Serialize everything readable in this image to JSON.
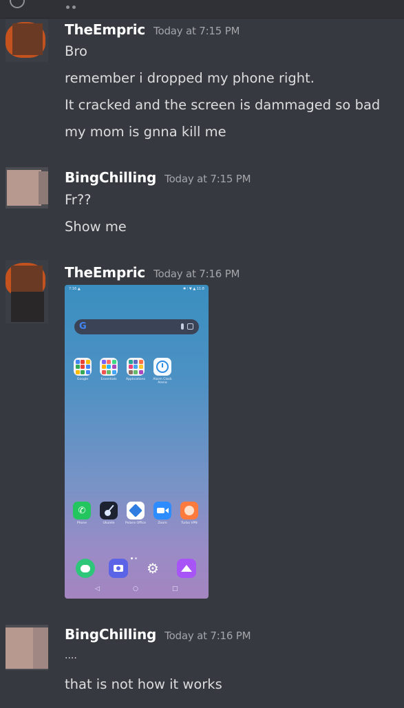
{
  "messages": [
    {
      "username": "TheEmpric",
      "timestamp": "Today at 7:15 PM",
      "lines": [
        "Bro",
        "remember i dropped my phone right.",
        "It cracked and the screen is dammaged so bad",
        "my mom is gnna kill me"
      ]
    },
    {
      "username": "BingChilling",
      "timestamp": "Today at 7:15 PM",
      "lines": [
        "Fr??",
        "Show me"
      ]
    },
    {
      "username": "TheEmpric",
      "timestamp": "Today at 7:16 PM",
      "lines": []
    },
    {
      "username": "BingChilling",
      "timestamp": "Today at 7:16 PM",
      "lines": [
        "....",
        "that is not how it works"
      ]
    }
  ],
  "phone_screenshot": {
    "status_left": "7:16 ▲",
    "status_right": "✱ ⁝ ▼ ▲ 11:8",
    "search_logo": "G",
    "top_apps": [
      {
        "label": "Google",
        "icon": "google-folder-icon"
      },
      {
        "label": "Essentials",
        "icon": "essentials-folder-icon"
      },
      {
        "label": "Applications",
        "icon": "applications-folder-icon"
      },
      {
        "label": "Alarm Clock Arena",
        "icon": "alarm-clock-icon"
      }
    ],
    "bottom_apps": [
      {
        "label": "Phone",
        "icon": "phone-icon"
      },
      {
        "label": "Ukulele",
        "icon": "ukulele-icon"
      },
      {
        "label": "Polaris Office",
        "icon": "polaris-office-icon"
      },
      {
        "label": "Zoom",
        "icon": "zoom-icon"
      },
      {
        "label": "Turbo VPN",
        "icon": "turbo-vpn-icon"
      }
    ],
    "dock_apps": [
      {
        "icon": "messages-icon"
      },
      {
        "icon": "camera-icon"
      },
      {
        "icon": "settings-icon"
      },
      {
        "icon": "gallery-icon"
      }
    ],
    "nav_back": "◁",
    "nav_home": "○",
    "nav_recent": "□"
  },
  "colors": {
    "background": "#36393f",
    "username": "#ffffff",
    "timestamp": "#a3a6aa",
    "message_text": "#dcddde"
  }
}
